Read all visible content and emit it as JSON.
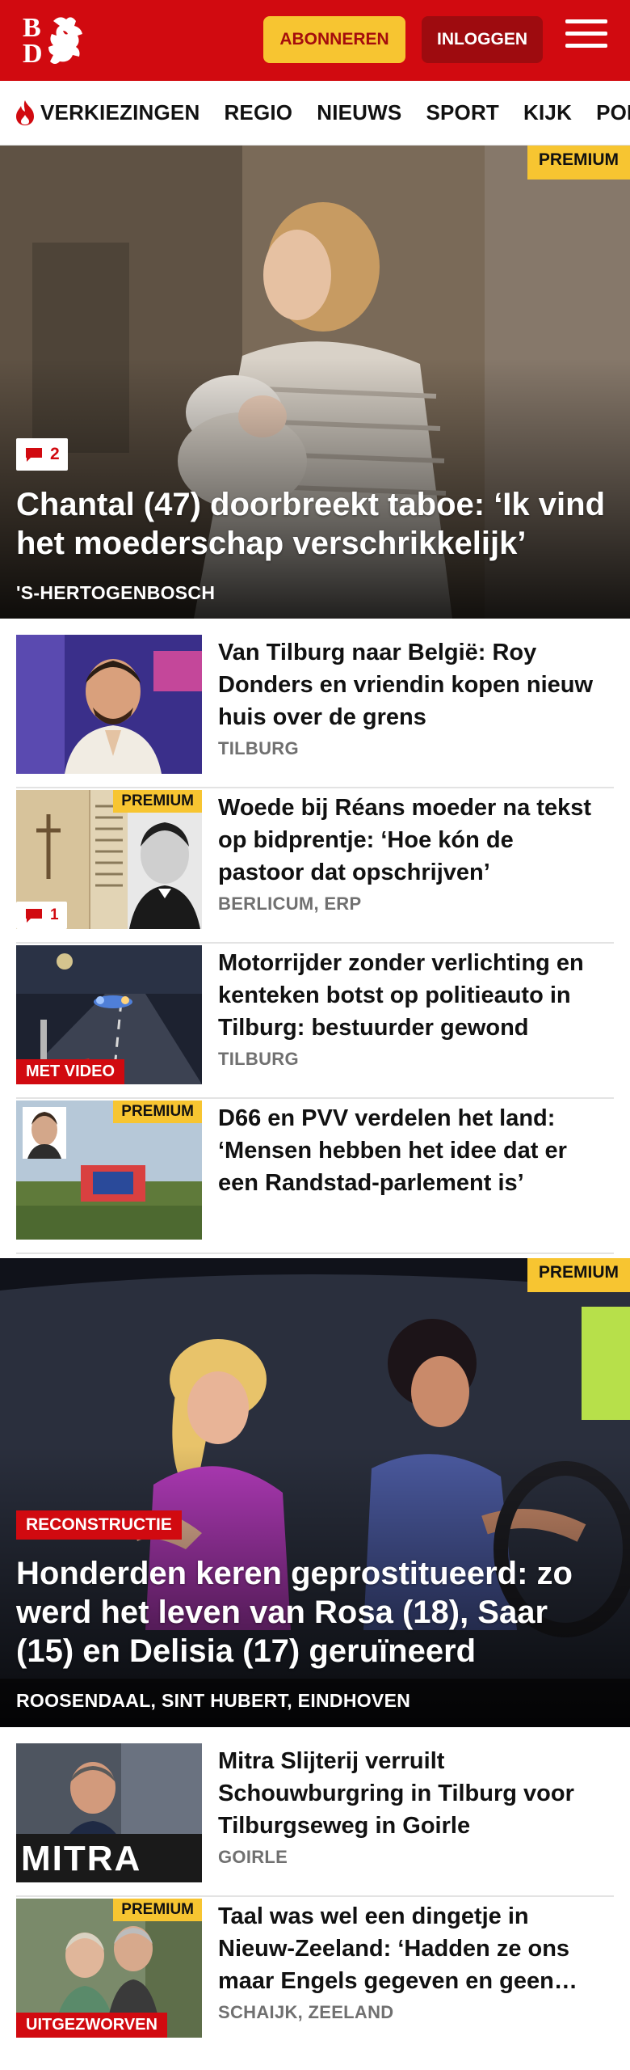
{
  "header": {
    "logo_letters": [
      "B",
      "D"
    ],
    "subscribe_label": "ABONNEREN",
    "login_label": "INLOGGEN"
  },
  "nav": {
    "items": [
      "VERKIEZINGEN",
      "REGIO",
      "NIEUWS",
      "SPORT",
      "KIJK",
      "PODC"
    ]
  },
  "premium_label": "PREMIUM",
  "hero1": {
    "comments": "2",
    "title": "Chantal (47) doorbreekt taboe: ‘Ik vind het moederschap verschrikkelijk’",
    "location": "'S-HERTOGENBOSCH"
  },
  "articles": [
    {
      "title": "Van Tilburg naar België: Roy Donders en vriendin kopen nieuw huis over de grens",
      "location": "TILBURG"
    },
    {
      "title": "Woede bij Réans moeder na tekst op bidprentje: ‘Hoe kón de pastoor dat opschrijven’",
      "location": "BERLICUM, ERP",
      "comments": "1"
    },
    {
      "title": "Motorrijder zonder verlichting en kenteken botst op politieauto in Tilburg: bestuurder gewond",
      "location": "TILBURG",
      "label": "MET VIDEO"
    },
    {
      "title": "D66 en PVV verdelen het land: ‘Mensen hebben het idee dat er een Randstad-parlement is’",
      "location": ""
    }
  ],
  "hero2": {
    "label": "RECONSTRUCTIE",
    "title": "Honderden keren geprostitueerd: zo werd het leven van Rosa (18), Saar (15) en Delisia (17) geruïneerd",
    "location": "ROOSENDAAL, SINT HUBERT, EINDHOVEN"
  },
  "articles2": [
    {
      "title": "Mitra Slijterij verruilt Schouwburgring in Tilburg voor Tilburgseweg in Goirle",
      "location": "GOIRLE",
      "thumb_text": "MITRA"
    },
    {
      "title": "Taal was wel een dingetje in Nieuw-Zeeland: ‘Hadden ze ons maar Engels gegeven en geen…",
      "location": "SCHAIJK, ZEELAND",
      "label": "UITGEZWORVEN"
    }
  ],
  "colors": {
    "brand_red": "#d10a10",
    "premium_yellow": "#f7c531",
    "dark_red": "#9e0b0f"
  }
}
